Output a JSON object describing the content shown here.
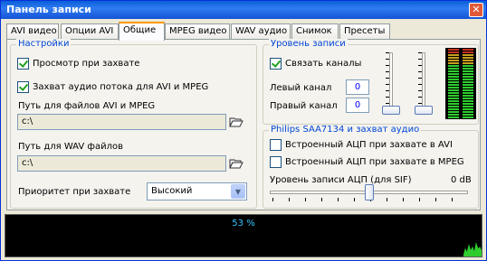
{
  "window": {
    "title": "Панель записи",
    "close_label": "✕"
  },
  "tabs": [
    {
      "label": "AVI видео"
    },
    {
      "label": "Опции AVI"
    },
    {
      "label": "Общие"
    },
    {
      "label": "MPEG видео"
    },
    {
      "label": "WAV аудио"
    },
    {
      "label": "Снимок"
    },
    {
      "label": "Пресеты"
    }
  ],
  "active_tab": "Общие",
  "settings": {
    "legend": "Настройки",
    "preview_checkbox": {
      "label": "Просмотр при захвате",
      "checked": true
    },
    "audio_checkbox": {
      "label": "Захват аудио потока для AVI и MPEG",
      "checked": true
    },
    "avi_path": {
      "label": "Путь для файлов AVI и MPEG",
      "value": "c:\\"
    },
    "wav_path": {
      "label": "Путь для WAV файлов",
      "value": "c:\\"
    },
    "priority": {
      "label": "Приоритет при захвате",
      "value": "Высокий"
    }
  },
  "record_level": {
    "legend": "Уровень записи",
    "link_channels": {
      "label": "Связать каналы",
      "checked": true
    },
    "left": {
      "label": "Левый канал",
      "value": "0"
    },
    "right": {
      "label": "Правый канал",
      "value": "0"
    }
  },
  "philips": {
    "legend": "Philips SAA7134 и захват аудио",
    "adc_avi": {
      "label": "Встроенный АЦП при захвате в AVI",
      "checked": false
    },
    "adc_mpeg": {
      "label": "Встроенный АЦП при захвате в MPEG",
      "checked": false
    },
    "adc_level": {
      "label": "Уровень записи АЦП (для SIF)",
      "value": "0 dB"
    }
  },
  "status": {
    "progress_text": "53 %"
  },
  "colors": {
    "legend": "#0046d5",
    "progress_text": "#36c1ff",
    "meter_green": "#2ecc2e",
    "meter_amber": "#c8a020",
    "meter_red": "#c03020"
  }
}
